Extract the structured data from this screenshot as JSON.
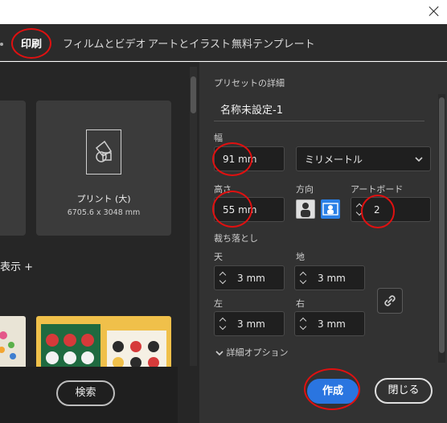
{
  "tabs": [
    {
      "label": "印刷"
    },
    {
      "label": "フィルムとビデオ"
    },
    {
      "label": "アートとイラスト"
    },
    {
      "label": "無料テンプレート"
    }
  ],
  "left": {
    "preset_card": {
      "title": "プリント (大)",
      "size": "6705.6 x 3048 mm"
    },
    "show_all_label": "表示 +",
    "search_label": "検索"
  },
  "details": {
    "heading": "プリセットの詳細",
    "name_value": "名称未設定-1",
    "width_label": "幅",
    "width_value": "91 mm",
    "unit_value": "ミリメートル",
    "height_label": "高さ",
    "height_value": "55 mm",
    "orientation_label": "方向",
    "artboard_label": "アートボード",
    "artboard_value": "2",
    "bleed_label": "裁ち落とし",
    "bleed": {
      "top_label": "天",
      "top_value": "3 mm",
      "bottom_label": "地",
      "bottom_value": "3 mm",
      "left_label": "左",
      "left_value": "3 mm",
      "right_label": "右",
      "right_value": "3 mm"
    },
    "advanced_label": "詳細オプション"
  },
  "footer": {
    "create_label": "作成",
    "close_label": "閉じる"
  },
  "colors": {
    "accent": "#2a75e0",
    "annotation": "#e01010"
  }
}
